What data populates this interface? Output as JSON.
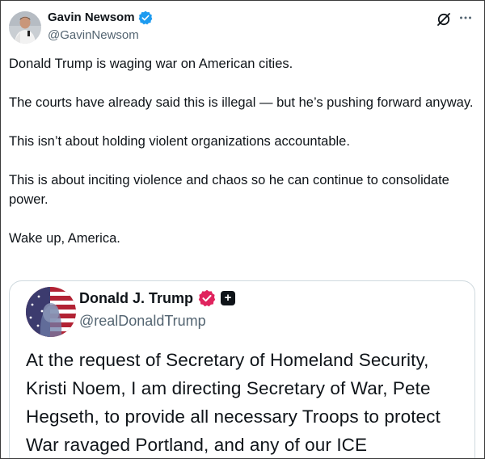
{
  "tweet": {
    "author_name": "Gavin Newsom",
    "handle": "@GavinNewsom",
    "paragraphs": [
      "Donald Trump is waging war on American cities.",
      "The courts have already said this is illegal — but he’s pushing forward anyway.",
      "This isn’t about holding violent organizations accountable.",
      "This is about inciting violence and chaos so he can continue to consolidate power.",
      "Wake up, America."
    ]
  },
  "quoted_tweet": {
    "author_name": "Donald J. Trump",
    "handle": "@realDonaldTrump",
    "text": "At the request of Secretary of Homeland Security, Kristi Noem, I am directing Secretary of War, Pete Hegseth, to provide all necessary Troops to protect War ravaged Portland, and any of our ICE"
  },
  "icons": {
    "verified_primary": "blue-verified-badge",
    "verified_quote": "pink-verified-badge",
    "quote_affiliate": "plus-badge-icon",
    "grok": "grok-icon",
    "more": "more-icon"
  },
  "colors": {
    "verified_blue": "#1d9bf0",
    "verified_pink": "#e0245e",
    "secondary_text": "#536471",
    "card_border": "#cfd9de"
  }
}
